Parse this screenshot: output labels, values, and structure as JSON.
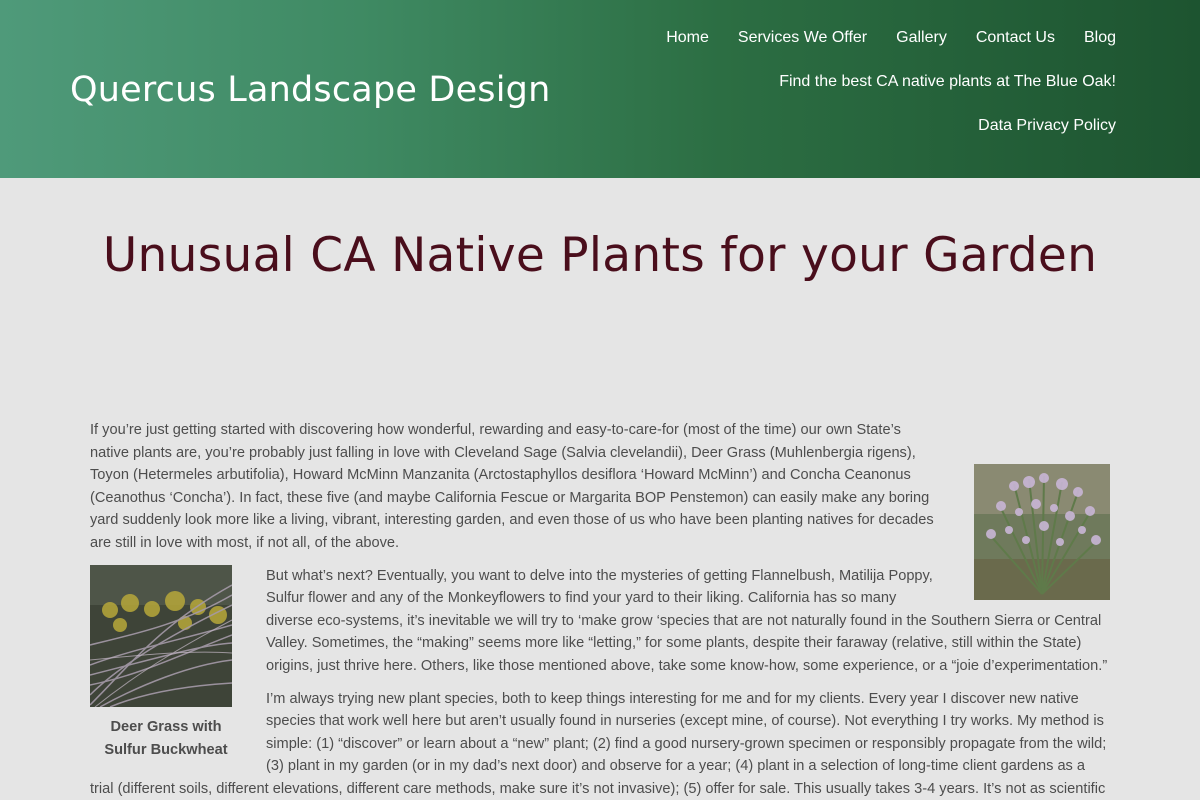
{
  "header": {
    "site_title": "Quercus Landscape Design",
    "brand_colors": {
      "header_start": "#4f9a7a",
      "header_end": "#1d5430",
      "title_color": "#4a0e1c"
    }
  },
  "nav": {
    "items": [
      {
        "label": "Home"
      },
      {
        "label": "Services We Offer"
      },
      {
        "label": "Gallery"
      },
      {
        "label": "Contact Us"
      },
      {
        "label": "Blog"
      },
      {
        "label": "Find the best CA native plants at The Blue Oak!"
      },
      {
        "label": "Data Privacy Policy"
      }
    ]
  },
  "article": {
    "title": "Unusual CA Native Plants for your Garden",
    "paragraphs": [
      "If you’re just getting started with discovering how wonderful, rewarding and easy-to-care-for (most of the time) our own State’s native plants are, you’re probably just falling in love with Cleveland Sage (Salvia clevelandii), Deer Grass (Muhlenbergia rigens), Toyon (Hetermeles arbutifolia), Howard McMinn Manzanita (Arctostaphyllos desiflora ‘Howard McMinn’) and Concha Ceanonus (Ceanothus ‘Concha’). In fact, these five (and maybe California Fescue or Margarita BOP Penstemon) can easily make any boring yard suddenly look more like a living, vibrant, interesting garden, and even those of us who have been planting natives for decades are still in love with most, if not all, of the above.",
      "But what’s next? Eventually, you want to delve into the mysteries of getting Flannelbush, Matilija Poppy, Sulfur flower and any of the Monkeyflowers to find your yard to their liking. California has so many diverse eco-systems, it’s inevitable we will try to ‘make grow ‘species that are not naturally found in the Southern Sierra or Central Valley. Sometimes, the “making” seems more like “letting,” for some plants, despite their faraway (relative, still within the State) origins, just thrive here. Others, like those mentioned above, take some know-how, some experience, or a “joie d’experimentation.”",
      "I’m always trying new plant species, both to keep things interesting for me and for my clients. Every year I discover new native species that work well here but aren’t usually found in nurseries (except mine, of course).  Not everything I try works. My method is simple: (1) “discover” or learn about a “new” plant; (2) find a good nursery-grown specimen or responsibly propagate from the wild; (3) plant in my garden (or in my dad’s next door) and observe for a year; (4) plant in a selection of long-time client gardens as a trial (different soils, different elevations, different care methods, make sure it’s not invasive); (5) offer for sale. This usually takes 3-4 years. It’s not as scientific as the big growers, but it’s"
    ],
    "figure_left_caption": "Deer Grass with Sulfur Buckwheat"
  }
}
